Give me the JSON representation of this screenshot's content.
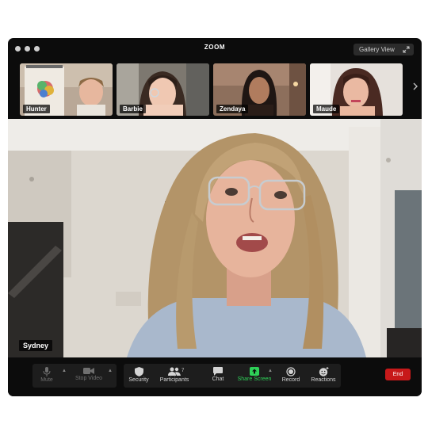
{
  "window": {
    "title": "ZOOM",
    "view_button_label": "Gallery View"
  },
  "participants": [
    {
      "name": "Hunter"
    },
    {
      "name": "Barbie"
    },
    {
      "name": "Zendaya"
    },
    {
      "name": "Maude"
    }
  ],
  "active_speaker": {
    "name": "Sydney"
  },
  "toolbar": {
    "mute_label": "Mute",
    "stop_video_label": "Stop Video",
    "security_label": "Security",
    "participants_label": "Participants",
    "participants_count": "7",
    "chat_label": "Chat",
    "share_screen_label": "Share Screen",
    "record_label": "Record",
    "reactions_label": "Reactions",
    "end_label": "End"
  },
  "colors": {
    "share_screen": "#2ed158",
    "end_button": "#c7191a",
    "window_bg": "#0c0c0c"
  }
}
